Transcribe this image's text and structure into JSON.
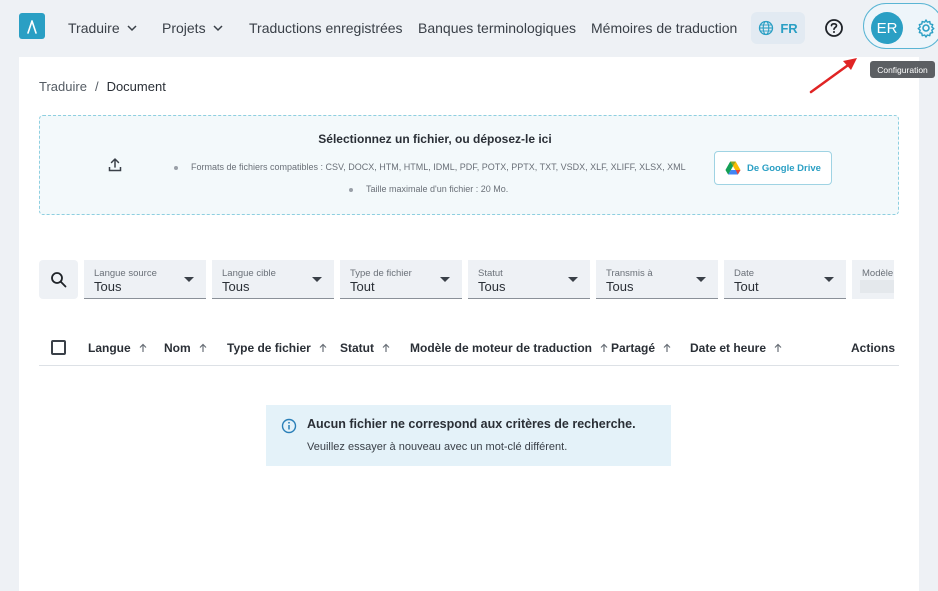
{
  "nav": {
    "items": [
      {
        "label": "Traduire",
        "has_dropdown": true
      },
      {
        "label": "Projets",
        "has_dropdown": true
      },
      {
        "label": "Traductions enregistrées",
        "has_dropdown": false
      },
      {
        "label": "Banques terminologiques",
        "has_dropdown": false
      },
      {
        "label": "Mémoires de traduction",
        "has_dropdown": false
      }
    ],
    "language": "FR",
    "avatar_initials": "ER",
    "tooltip": "Configuration"
  },
  "breadcrumb": {
    "root": "Traduire",
    "separator": "/",
    "current": "Document"
  },
  "dropzone": {
    "title": "Sélectionnez un fichier, ou déposez-le ici",
    "formats": "Formats de fichiers compatibles : CSV, DOCX, HTM, HTML, IDML, PDF, POTX, PPTX, TXT, VSDX, XLF, XLIFF, XLSX, XML",
    "max_size": "Taille maximale d'un fichier : 20 Mo.",
    "gdrive_label": "De Google Drive"
  },
  "filters": [
    {
      "label": "Langue source",
      "value": "Tous"
    },
    {
      "label": "Langue cible",
      "value": "Tous"
    },
    {
      "label": "Type de fichier",
      "value": "Tout"
    },
    {
      "label": "Statut",
      "value": "Tous"
    },
    {
      "label": "Transmis à",
      "value": "Tous"
    },
    {
      "label": "Date",
      "value": "Tout"
    },
    {
      "label": "Modèle",
      "value": ""
    }
  ],
  "table": {
    "columns": [
      "Langue",
      "Nom",
      "Type de fichier",
      "Statut",
      "Modèle de moteur de traduction",
      "Partagé",
      "Date et heure",
      "Actions"
    ]
  },
  "notice": {
    "title": "Aucun fichier ne correspond aux critères de recherche.",
    "subtitle": "Veuillez essayer à nouveau avec un mot-clé différent."
  },
  "colors": {
    "accent": "#2a9fc4",
    "annotation_arrow": "#e02424"
  }
}
